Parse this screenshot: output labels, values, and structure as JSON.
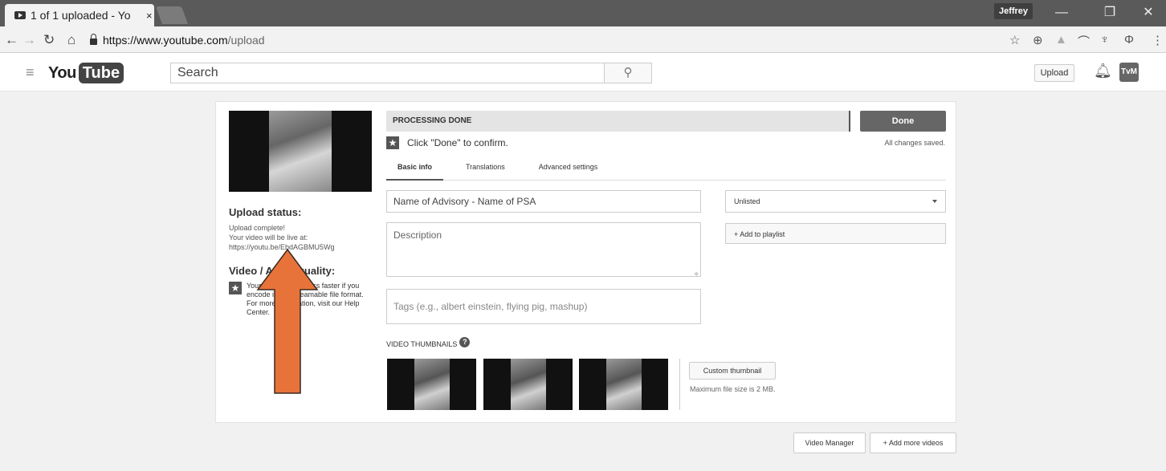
{
  "browser": {
    "tab_title": "1 of 1 uploaded - Yo",
    "tab_close": "×",
    "user": "Jeffrey",
    "window_controls": [
      "—",
      "❐",
      "✕"
    ],
    "url_host": "https://www.youtube.com",
    "url_path": "/upload",
    "nav_icons": [
      "back-arrow-icon",
      "forward-arrow-icon",
      "reload-icon",
      "home-icon"
    ],
    "extension_icons": [
      "bookmark-star-icon",
      "extension-icon",
      "drive-icon",
      "extension-icon",
      "trophy-icon",
      "pin-icon",
      "menu-dots-icon"
    ]
  },
  "header": {
    "logo_you": "You",
    "logo_tube": "Tube",
    "search_placeholder": "Search",
    "upload_label": "Upload",
    "avatar_text": "TvM"
  },
  "left": {
    "upload_status_heading": "Upload status:",
    "upload_complete": "Upload complete!",
    "live_at": "Your video will be live at:",
    "video_url": "https://youtu.be/EbdAGBMU5Wg",
    "quality_heading": "Video / Audio quality:",
    "quality_text": "Your video will process faster if you encode into a streamable file format. For more information, visit our Help Center."
  },
  "main": {
    "processing_status": "PROCESSING DONE",
    "done_label": "Done",
    "confirm_text": "Click \"Done\" to confirm.",
    "saved_text": "All changes saved.",
    "tabs": [
      {
        "label": "Basic info",
        "active": true
      },
      {
        "label": "Translations",
        "active": false
      },
      {
        "label": "Advanced settings",
        "active": false
      }
    ],
    "title_value": "Name of Advisory - Name of PSA",
    "description_placeholder": "Description",
    "tags_placeholder": "Tags (e.g., albert einstein, flying pig, mashup)",
    "visibility": "Unlisted",
    "add_to_playlist": "+ Add to playlist",
    "thumbnails_label": "VIDEO THUMBNAILS",
    "custom_thumbnail": "Custom thumbnail",
    "max_file_size": "Maximum file size is 2 MB."
  },
  "footer": {
    "video_manager": "Video Manager",
    "add_more_videos": "+ Add more videos"
  },
  "colors": {
    "annotation_arrow": "#e8733a",
    "annotation_arrow_stroke": "#3a2a20"
  }
}
